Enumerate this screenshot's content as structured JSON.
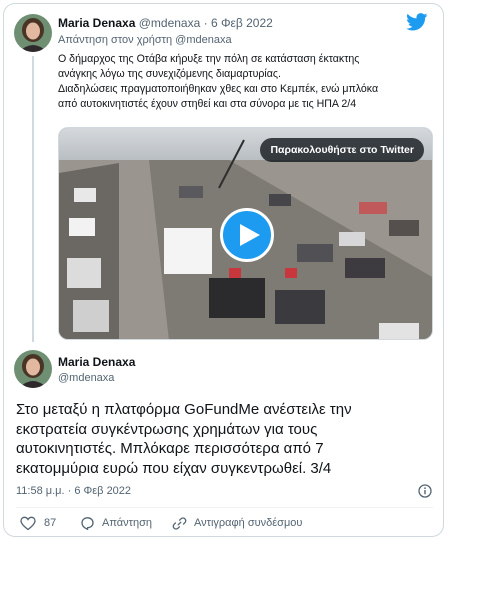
{
  "reply_tweet": {
    "author_name": "Maria Denaxa",
    "author_handle": "@mdenaxa",
    "date": "· 6 Φεβ 2022",
    "replying_to_prefix": "Απάντηση στον χρήστη",
    "replying_to_handle": "@mdenaxa",
    "text_line1": "Ο δήμαρχος της Οτάβα κήρυξε την πόλη σε κατάσταση έκτακτης",
    "text_line2": "ανάγκης λόγω της συνεχιζόμενης διαμαρτυρίας.",
    "text_line3": "Διαδηλώσεις πραγματοποιήθηκαν χθες και στο Κεμπέκ, ενώ μπλόκα",
    "text_line4": "από αυτοκινητιστές έχουν στηθεί και στα σύνορα με τις ΗΠΑ 2/4",
    "video_button_label": "Παρακολουθήστε στο Twitter"
  },
  "main_tweet": {
    "author_name": "Maria Denaxa",
    "author_handle": "@mdenaxa",
    "text_line1": "Στο μεταξύ  η πλατφόρμα GoFundMe ανέστειλε την",
    "text_line2": "εκστρατεία συγκέντρωσης χρημάτων για τους",
    "text_line3": "αυτοκινητιστές. Μπλόκαρε περισσότερα από 7",
    "text_line4": "εκατομμύρια ευρώ που είχαν συγκεντρωθεί. 3/4",
    "timestamp": "11:58 μ.μ. · 6 Φεβ 2022",
    "likes": "87",
    "reply_label": "Απάντηση",
    "copy_link_label": "Αντιγραφή συνδέσμου"
  },
  "icons": {
    "logo": "twitter-bird-icon",
    "play": "play-icon",
    "info": "info-icon",
    "like": "heart-icon",
    "reply": "speech-bubble-icon",
    "copy": "link-icon"
  },
  "colors": {
    "accent": "#1d9bf0",
    "text": "#0f1419",
    "secondary": "#536471",
    "border": "#cfd9de"
  }
}
